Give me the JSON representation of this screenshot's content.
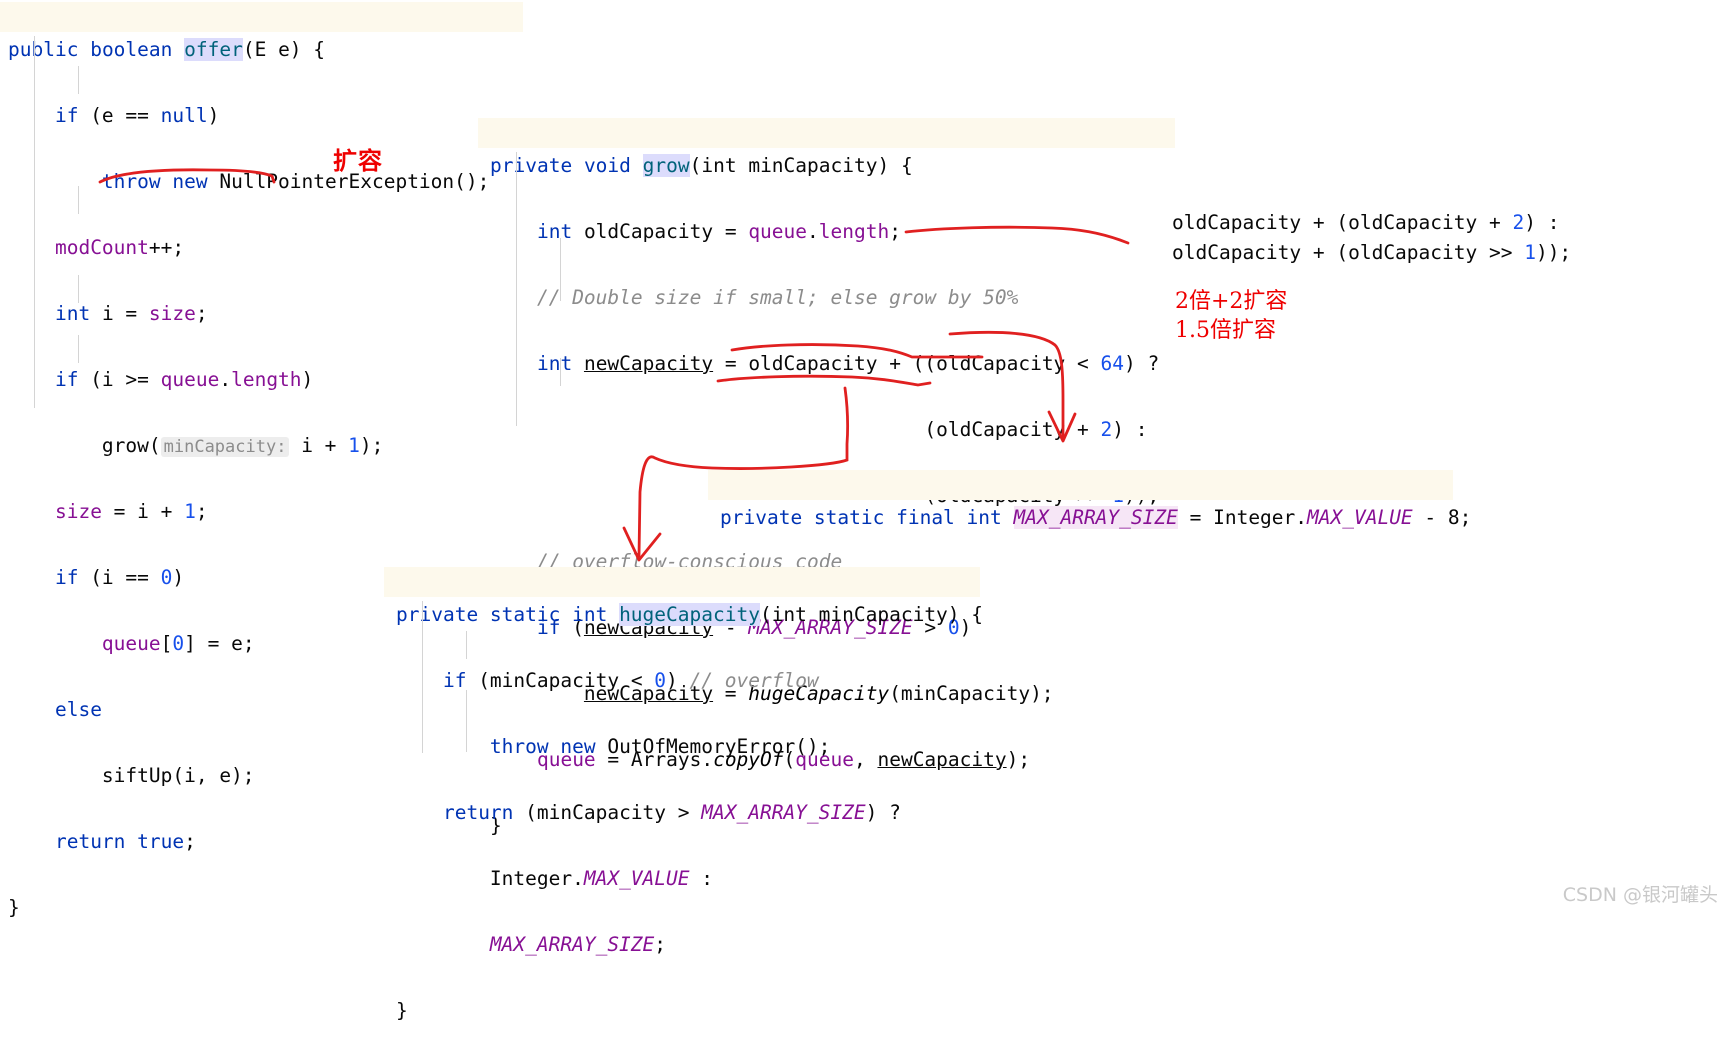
{
  "document": {
    "kind": "java-source-code-annotated-screenshot",
    "watermark": "CSDN @银河罐头"
  },
  "offer_method": {
    "signature": "public boolean offer(E e) {",
    "sig_parts": {
      "mod": "public",
      "ret": "boolean",
      "name": "offer",
      "args": "(E e) {"
    },
    "lines": [
      "    if (e == null)",
      "        throw new NullPointerException();",
      "    modCount++;",
      "    int i = size;",
      "    if (i >= queue.length)",
      "        grow( minCapacity: i + 1);",
      "    size = i + 1;",
      "    if (i == 0)",
      "        queue[0] = e;",
      "    else",
      "        siftUp(i, e);",
      "    return true;",
      "}"
    ],
    "param_hint": "minCapacity:"
  },
  "grow_method": {
    "signature": "private void grow(int minCapacity) {",
    "sig_parts": {
      "mod": "private",
      "ret": "void",
      "name": "grow",
      "args": "(int minCapacity) {"
    },
    "lines": [
      "    int oldCapacity = queue.length;",
      "    // Double size if small; else grow by 50%",
      "    int newCapacity = oldCapacity + ((oldCapacity < 64) ?",
      "                                     (oldCapacity + 2) :",
      "                                     (oldCapacity >> 1));",
      "    // overflow-conscious code",
      "    if (newCapacity - MAX_ARRAY_SIZE > 0)",
      "        newCapacity = hugeCapacity(minCapacity);",
      "    queue = Arrays.copyOf(queue, newCapacity);",
      "}"
    ],
    "comment_double": "// Double size if small; else grow by 50%",
    "comment_overflow": "// overflow-conscious code"
  },
  "expanded_expressions": {
    "line1": "oldCapacity + (oldCapacity + 2) :",
    "line2": "oldCapacity + (oldCapacity >> 1));"
  },
  "annotations": {
    "grow_label": "扩容",
    "double_plus_two": "2倍+2扩容",
    "one_point_five": "1.5倍扩容",
    "arrow_color": "#e02020"
  },
  "max_array_size_decl": {
    "text": "private static final int MAX_ARRAY_SIZE = Integer.MAX_VALUE - 8;",
    "parts": {
      "mods": "private static final int ",
      "const": "MAX_ARRAY_SIZE",
      "eq": " = Integer.",
      "field": "MAX_VALUE",
      "tail": " - 8;"
    }
  },
  "huge_capacity_method": {
    "signature": "private static int hugeCapacity(int minCapacity) {",
    "sig_parts": {
      "mods": "private static int ",
      "name": "hugeCapacity",
      "args": "(int minCapacity) {"
    },
    "lines": [
      "    if (minCapacity < 0) // overflow",
      "        throw new OutOfMemoryError();",
      "    return (minCapacity > MAX_ARRAY_SIZE) ?",
      "        Integer.MAX_VALUE :",
      "        MAX_ARRAY_SIZE;",
      "}"
    ],
    "comment_overflow": "// overflow"
  },
  "colors": {
    "keyword": "#0033b3",
    "method": "#00627a",
    "field": "#871094",
    "number": "#1750eb",
    "comment": "#8c8c8c",
    "signature_bg": "#fdf9ec",
    "method_highlight_bg": "#dcdcfc",
    "const_highlight_bg": "#f6e6f6",
    "annotation_red": "#e02020"
  }
}
